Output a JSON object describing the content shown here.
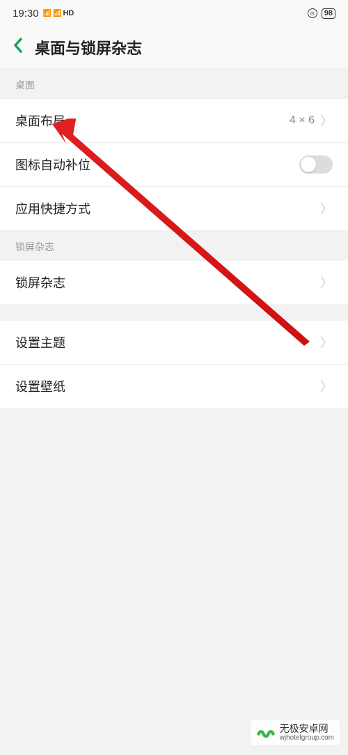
{
  "statusBar": {
    "time": "19:30",
    "signal1": "⁴ᴳ",
    "signal2": "₅ᴳ",
    "hd": "ʜᴅ",
    "battery": "98"
  },
  "header": {
    "title": "桌面与锁屏杂志"
  },
  "sections": {
    "desktop": {
      "header": "桌面",
      "layout": {
        "label": "桌面布局",
        "value": "4 × 6"
      },
      "autofill": {
        "label": "图标自动补位"
      },
      "shortcut": {
        "label": "应用快捷方式"
      }
    },
    "lockscreen": {
      "header": "锁屏杂志",
      "magazine": {
        "label": "锁屏杂志"
      }
    },
    "settings": {
      "theme": {
        "label": "设置主题"
      },
      "wallpaper": {
        "label": "设置壁纸"
      }
    }
  },
  "watermark": {
    "title": "无极安卓网",
    "url": "wjhotelgroup.com"
  }
}
